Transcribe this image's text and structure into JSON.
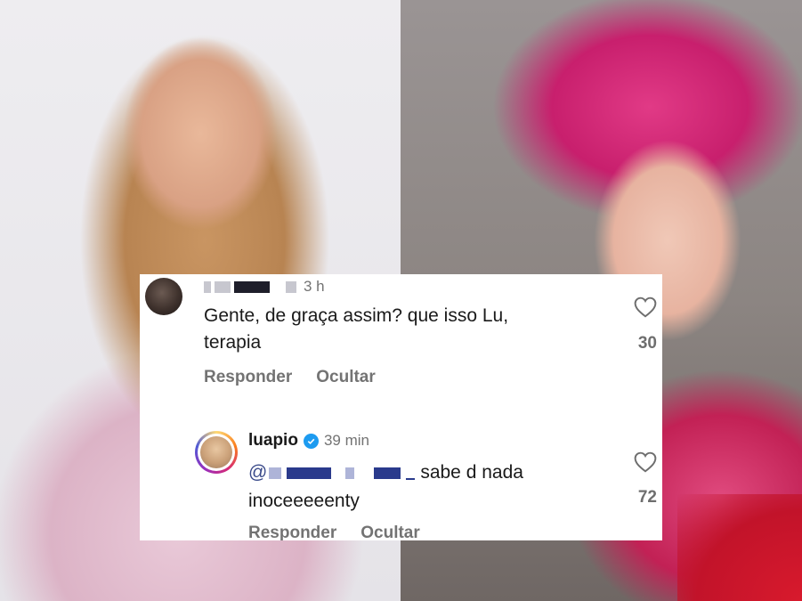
{
  "comment1": {
    "time": "3 h",
    "text_line1": "Gente, de graça assim? que isso Lu,",
    "text_line2": "terapia",
    "likes": "30",
    "reply_label": "Responder",
    "hide_label": "Ocultar"
  },
  "comment2": {
    "username": "luapio",
    "time": "39 min",
    "at": "@",
    "text_suffix": "sabe d nada",
    "text_line2": "inoceeeeenty",
    "likes": "72",
    "reply_label": "Responder",
    "hide_label": "Ocultar"
  },
  "icons": {
    "like": "heart-icon",
    "verified": "verified-badge-icon"
  },
  "colors": {
    "card_bg": "#ffffff",
    "secondary_text": "#737373",
    "verified": "#1d9bf0",
    "mention": "#2a3a8c"
  }
}
